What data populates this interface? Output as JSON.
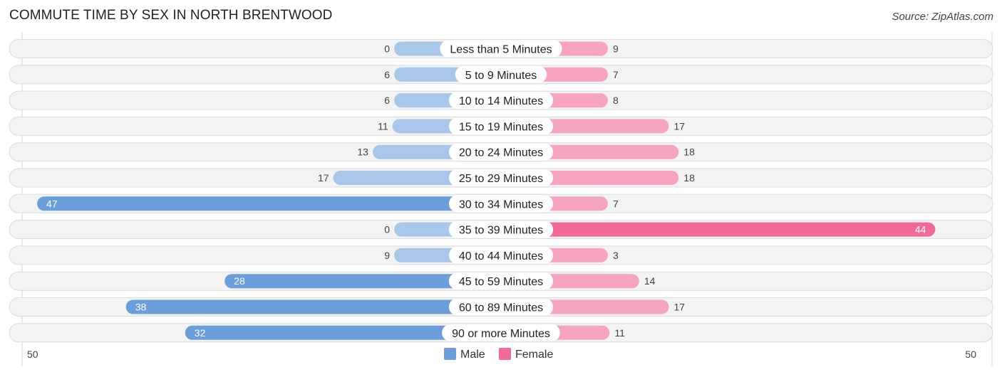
{
  "header": {
    "title": "COMMUTE TIME BY SEX IN NORTH BRENTWOOD",
    "source": "Source: ZipAtlas.com"
  },
  "colors": {
    "male": "#6a9fdc",
    "male_light": "#a9c7ea",
    "female": "#f26a96",
    "female_light": "#f6a4bf"
  },
  "chart_data": {
    "type": "bar",
    "orientation": "horizontal-diverging",
    "title": "COMMUTE TIME BY SEX IN NORTH BRENTWOOD",
    "categories": [
      "Less than 5 Minutes",
      "5 to 9 Minutes",
      "10 to 14 Minutes",
      "15 to 19 Minutes",
      "20 to 24 Minutes",
      "25 to 29 Minutes",
      "30 to 34 Minutes",
      "35 to 39 Minutes",
      "40 to 44 Minutes",
      "45 to 59 Minutes",
      "60 to 89 Minutes",
      "90 or more Minutes"
    ],
    "series": [
      {
        "name": "Male",
        "values": [
          0,
          6,
          6,
          11,
          13,
          17,
          47,
          0,
          9,
          28,
          38,
          32
        ]
      },
      {
        "name": "Female",
        "values": [
          9,
          7,
          8,
          17,
          18,
          18,
          7,
          44,
          3,
          14,
          17,
          11
        ]
      }
    ],
    "axis": {
      "left_tick": "50",
      "right_tick": "50",
      "range": [
        0,
        50
      ]
    },
    "legend": {
      "position": "bottom-center",
      "entries": [
        "Male",
        "Female"
      ]
    },
    "grid": false
  }
}
